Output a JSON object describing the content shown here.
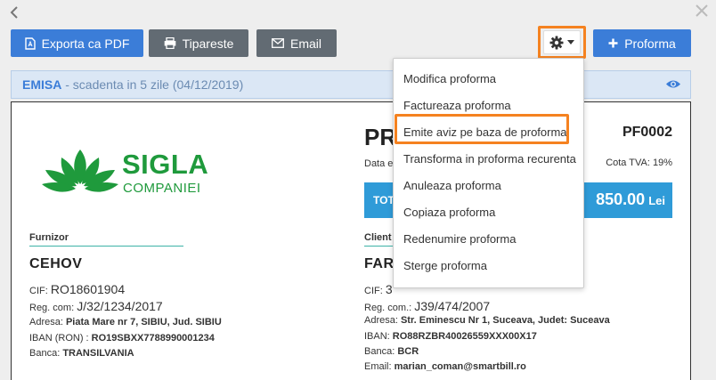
{
  "window": {
    "back_icon": "chevron-left-icon",
    "close_icon": "close-icon"
  },
  "toolbar": {
    "export_pdf_label": "Exporta ca PDF",
    "print_label": "Tipareste",
    "email_label": "Email",
    "proforma_label": "Proforma"
  },
  "status": {
    "state": "EMISA",
    "due_text": " - scadenta in 5 zile (04/12/2019)"
  },
  "menu": {
    "items": [
      "Modifica proforma",
      "Factureaza proforma",
      "Emite aviz pe baza de proforma",
      "Transforma in proforma recurenta",
      "Anuleaza proforma",
      "Copiaza proforma",
      "Redenumire proforma",
      "Sterge proforma"
    ],
    "highlighted_index": 2
  },
  "document": {
    "logo_text_main": "SIGLA",
    "logo_text_sub": "COMPANIEI",
    "title_partial": "PR",
    "number": "PF0002",
    "date_label_partial": "Data e",
    "tva": "Cota TVA: 19%",
    "total_label_partial": "TOT",
    "total_value": "850.00",
    "total_currency": "Lei",
    "supplier": {
      "section": "Furnizor",
      "name": "CEHOV",
      "cif_label": "CIF: ",
      "cif": "RO18601904",
      "reg_label": "Reg. com: ",
      "reg": "J/32/1234/2017",
      "address_label": "Adresa: ",
      "address": "Piata Mare nr 7, SIBIU, Jud. SIBIU",
      "iban_label": "IBAN (RON) : ",
      "iban": "RO19SBXX7788990001234",
      "bank_label": "Banca: ",
      "bank": "TRANSILVANIA"
    },
    "client": {
      "section": "Client",
      "name": "FAR",
      "cif_label": "CIF: ",
      "cif": "3",
      "reg_label": "Reg. com.: ",
      "reg": "J39/474/2007",
      "address_label": "Adresa: ",
      "address": "Str. Eminescu Nr 1, Suceava, Judet: Suceava",
      "iban_label": "IBAN: ",
      "iban": "RO88RZBR40026559XXX00X17",
      "bank_label": "Banca: ",
      "bank": "BCR",
      "email_label": "Email: ",
      "email": "marian_coman@smartbill.ro"
    }
  },
  "colors": {
    "primary": "#3b7dd8",
    "secondary": "#626b73",
    "highlight": "#f58220",
    "logo_green": "#1f9a3c",
    "total_bar": "#2f9bd8"
  }
}
